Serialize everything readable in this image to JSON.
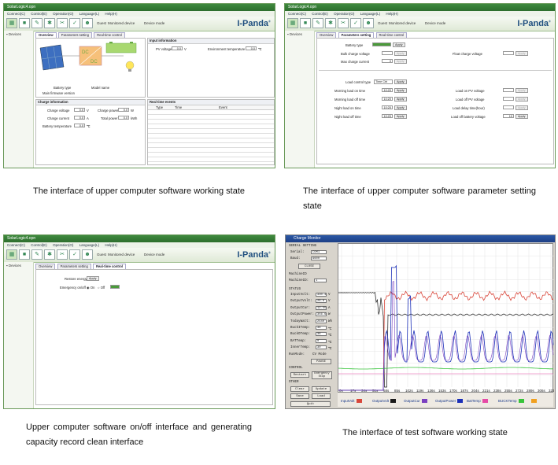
{
  "software": {
    "window_title": "SolarLogic4.opn",
    "menu": [
      "Connect(C)",
      "Control(E)",
      "Operation(O)",
      "Language(L)",
      "Help(H)"
    ],
    "guest": "Guest",
    "monitored_device": "Monitored device",
    "device_mode": "Device mode",
    "logo_text": "I-Panda",
    "logo_mark": "®",
    "devices_label": "Devices",
    "tabs": [
      "Overview",
      "Parameters setting",
      "Real-time control"
    ],
    "colors": {
      "title": "#2e6e2e",
      "accent": "#4a9a3a",
      "logo": "#1f4f7f"
    }
  },
  "panel1": {
    "battery_type_label": "Battery type",
    "model_name_label": "Model name",
    "firmware_label": "Main firmware version",
    "dc_label": "DC",
    "input_info": {
      "title": "Input information",
      "pv_voltage_label": "PV voltage",
      "pv_voltage_value": "0.0",
      "pv_voltage_unit": "V",
      "env_temp_label": "Environment temperature",
      "env_temp_value": "0.0",
      "env_temp_unit": "℃"
    },
    "charge_info": {
      "title": "Charge information",
      "charge_voltage_label": "Charge voltage",
      "charge_voltage_value": "0.0",
      "charge_voltage_unit": "V",
      "charge_power_label": "Charge power",
      "charge_power_value": "0.0",
      "charge_power_unit": "W",
      "charge_current_label": "Charge current",
      "charge_current_value": "0.0",
      "charge_current_unit": "A",
      "total_power_label": "Total power",
      "total_power_value": "0.0",
      "total_power_unit": "kWh",
      "battery_temp_label": "Battery temperature",
      "battery_temp_value": "0.0",
      "battery_temp_unit": "℃"
    },
    "realtime_events": {
      "title": "Real time events",
      "columns": [
        "Type",
        "Time",
        "Event"
      ]
    }
  },
  "panel2": {
    "battery_type_label": "Battery type",
    "apply": "Apply",
    "bulk_charge_voltage_label": "Bulk charge voltage",
    "float_charge_voltage_label": "Float charge voltage",
    "max_charge_current_label": "Max charge current",
    "max_charge_current_value": "0",
    "load_control_type_label": "Load control type",
    "load_control_type_value": "Time Ctrl",
    "rows_left": [
      {
        "label": "Morning load on time",
        "value": "10:20"
      },
      {
        "label": "Morning load off time",
        "value": "10:20"
      },
      {
        "label": "Night load on time",
        "value": "10:20"
      },
      {
        "label": "Night load off time",
        "value": "10:20"
      }
    ],
    "rows_right": [
      {
        "label": "Load on PV voltage",
        "value": ""
      },
      {
        "label": "Load off PV voltage",
        "value": ""
      },
      {
        "label": "Load delay time(hour)",
        "value": ""
      },
      {
        "label": "Load off battery voltage",
        "value": "10"
      }
    ]
  },
  "panel3": {
    "restore_label": "Restore energy",
    "apply": "Apply",
    "emergency_label": "Emergency on/off",
    "on": "On",
    "off": "Off"
  },
  "panel4": {
    "title": "Charge Monitor",
    "serial_setting": "SERIAL SETTING",
    "serial_label": "Serial:",
    "serial_value": "COM1",
    "baud_label": "Baud:",
    "baud_value": "9600",
    "close_btn": "CLOSE",
    "machine_id_title": "MachineID",
    "machine_id_label": "MachineID:",
    "machine_id_value": "1",
    "status_title": "STATUS",
    "status_rows": [
      {
        "label": "InputVolt:",
        "value": "330.4",
        "unit": "V"
      },
      {
        "label": "OutputVolt:",
        "value": "26.6",
        "unit": "V"
      },
      {
        "label": "OutputCur:",
        "value": "12.55",
        "unit": "A"
      },
      {
        "label": "OutputPower:",
        "value": "356.6",
        "unit": "W"
      },
      {
        "label": "TodayWatt:",
        "value": "2440",
        "unit": "Wh"
      },
      {
        "label": "BuckITemp:",
        "value": "36",
        "unit": "℃"
      },
      {
        "label": "BuckOTemp:",
        "value": "36",
        "unit": "℃"
      },
      {
        "label": "BATTemp:",
        "value": "0",
        "unit": "℃"
      },
      {
        "label": "InnerTemp:",
        "value": "30",
        "unit": "℃"
      }
    ],
    "run_mode_label": "RunMode:",
    "run_mode_value": "CV Mode",
    "pause_btn": "PAUSE",
    "control_title": "CONTROL",
    "restart_btn": "Restart",
    "emergency_btn": "Emergency Stop",
    "other_title": "OTHER",
    "clear_btn": "Clear",
    "update_btn": "Update",
    "save_btn": "Save",
    "load_btn": "Load",
    "quit_btn": "Quit",
    "legend": [
      {
        "name": "InputVolt",
        "color": "#d9463a"
      },
      {
        "name": "OutputVolt",
        "color": "#1a1a1a"
      },
      {
        "name": "OutputCur",
        "color": "#7a3fc0"
      },
      {
        "name": "OutputPower",
        "color": "#1b2fb8"
      },
      {
        "name": "BatTemp",
        "color": "#e64aa6"
      },
      {
        "name": "BUCKTemp",
        "color": "#37c43a"
      },
      {
        "name": "",
        "color": "#f0a020"
      }
    ],
    "x_ticks": [
      "0s",
      "17s",
      "34s",
      "51s",
      "68s",
      "85s",
      "102s",
      "119s",
      "136s",
      "153s",
      "170s",
      "187s",
      "204s",
      "221s",
      "238s",
      "255s",
      "272s",
      "289s",
      "306s",
      "323s"
    ]
  },
  "captions": {
    "c1": "The interface of upper computer software working state",
    "c2": "The interface of upper computer software parameter setting state",
    "c3": "Upper computer software on/off interface and generating capacity record clean interface",
    "c4": "The interface of test software working state"
  }
}
